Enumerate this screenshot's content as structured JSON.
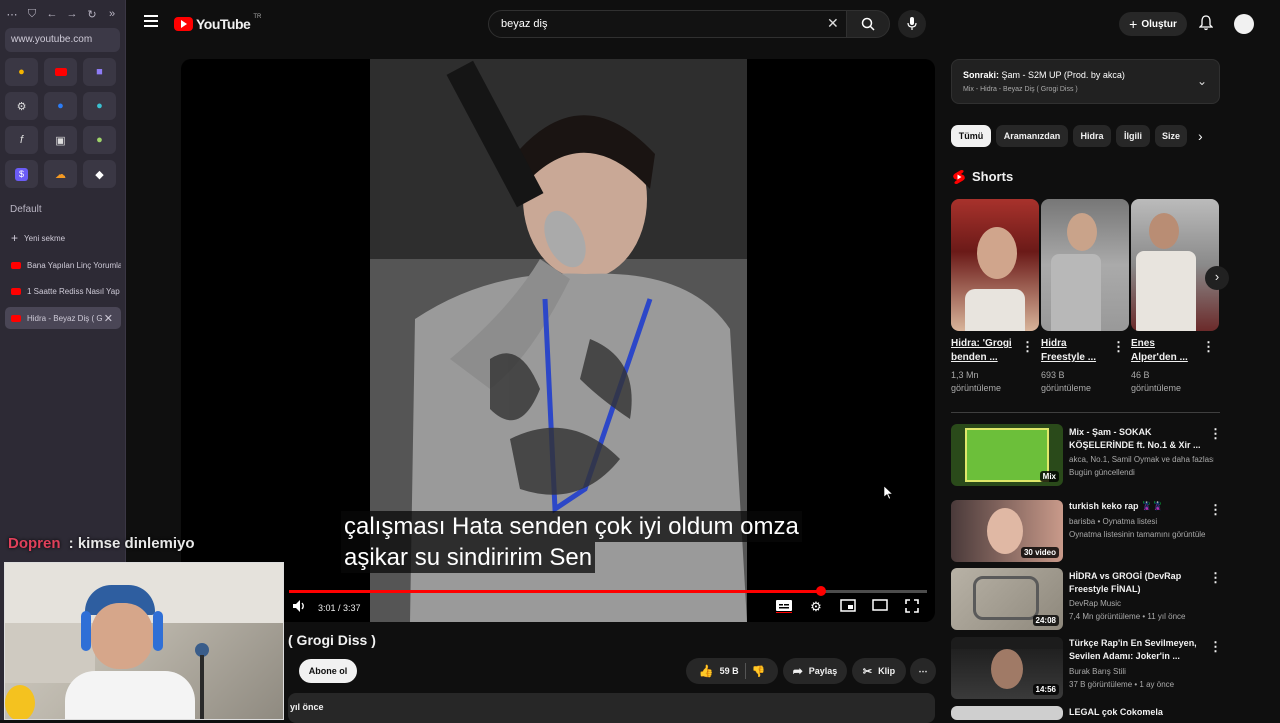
{
  "browser": {
    "url": "www.youtube.com",
    "section_label": "Default",
    "new_tab_label": "Yeni sekme",
    "tabs": [
      {
        "label": "Bana Yapılan Linç Yorumla"
      },
      {
        "label": "1 Saatte Rediss Nasıl Yap"
      },
      {
        "label": "Hidra - Beyaz Diş ( G"
      }
    ]
  },
  "header": {
    "logo_text": "YouTube",
    "logo_region": "TR",
    "search_value": "beyaz diş",
    "create_label": "Oluştur"
  },
  "player": {
    "subtitle_line1": "çalışması Hata senden çok iyi oldum omza",
    "subtitle_line2": "aşikar su sindiririm Sen",
    "time": "3:01 / 3:37",
    "progress": 0.834
  },
  "video": {
    "title_visible": "( Grogi Diss )",
    "subscribe_label": "Abone ol",
    "like_count": "59 B",
    "share_label": "Paylaş",
    "clip_label": "Klip",
    "desc_visible": "yıl önce"
  },
  "up_next": {
    "title_prefix": "Sonraki:",
    "title": "Şam - S2M UP (Prod. by akca)",
    "subtitle": "Mix - Hidra - Beyaz Diş ( Grogi Diss )"
  },
  "chips": [
    "Tümü",
    "Aramanızdan",
    "Hidra",
    "İlgili",
    "Size"
  ],
  "shorts": {
    "label": "Shorts",
    "items": [
      {
        "title": "Hidra: 'Grogi benden ...",
        "views": "1,3 Mn görüntüleme"
      },
      {
        "title": "Hidra Freestyle ...",
        "views": "693 B görüntüleme"
      },
      {
        "title": "Enes Alper'den ...",
        "views": "46 B görüntüleme"
      }
    ]
  },
  "recommendations": [
    {
      "title": "Mix - Şam - SOKAK KÖŞELERİNDE ft. No.1 & Xir ...",
      "channel": "akca, No.1, Samil Oymak ve daha fazlası",
      "meta": "Bugün güncellendi",
      "badge": "Mix"
    },
    {
      "title": "turkish keko rap 🦹‍♀️🦹",
      "channel": "barisba • Oynatma listesi",
      "meta": "Oynatma listesinin tamamını görüntüle",
      "badge": "30 video"
    },
    {
      "title": "HİDRA vs GROGİ (DevRap Freestyle FİNAL)",
      "channel": "DevRap Music",
      "meta": "7,4 Mn görüntüleme • 11 yıl önce",
      "badge": "24:08"
    },
    {
      "title": "Türkçe Rap'in En Sevilmeyen, Sevilen Adamı: Joker'in ...",
      "channel": "Burak Barış Stili",
      "meta": "37 B görüntüleme • 1 ay önce",
      "badge": "14:56"
    },
    {
      "title": "LEGAL çok Cokomela",
      "channel": "",
      "meta": "",
      "badge": ""
    }
  ],
  "stream_overlay": {
    "chat_user": "Dopren",
    "chat_message": ": kimse dinlemiyo"
  },
  "colors": {
    "accent": "#ff0000",
    "background": "#0f0f0f",
    "chat_user": "#e0405a"
  }
}
